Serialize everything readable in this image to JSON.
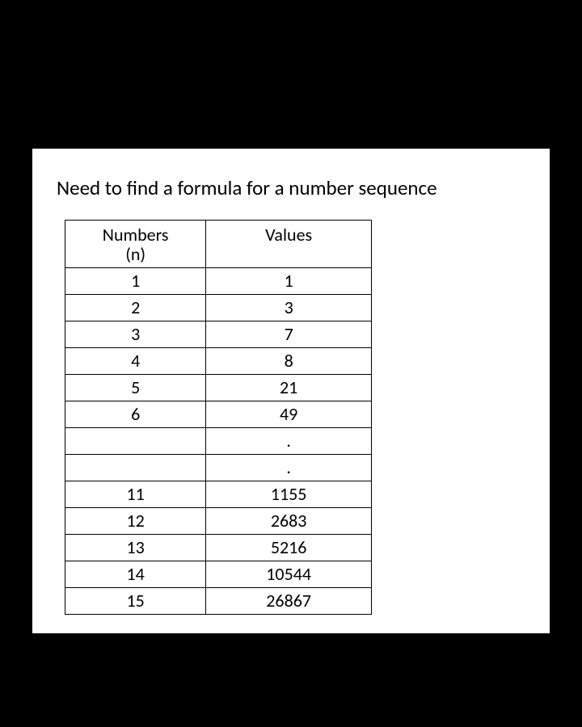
{
  "title": "Need to find a formula for a number sequence",
  "table": {
    "header_numbers_line1": "Numbers",
    "header_numbers_line2": "(n)",
    "header_values": "Values",
    "rows": [
      {
        "n": "1",
        "v": "1"
      },
      {
        "n": "2",
        "v": "3"
      },
      {
        "n": "3",
        "v": "7"
      },
      {
        "n": "4",
        "v": "8"
      },
      {
        "n": "5",
        "v": "21"
      },
      {
        "n": "6",
        "v": "49"
      },
      {
        "n": "",
        "v": "."
      },
      {
        "n": "",
        "v": "."
      },
      {
        "n": "11",
        "v": "1155"
      },
      {
        "n": "12",
        "v": "2683"
      },
      {
        "n": "13",
        "v": "5216"
      },
      {
        "n": "14",
        "v": "10544"
      },
      {
        "n": "15",
        "v": "26867"
      }
    ]
  }
}
